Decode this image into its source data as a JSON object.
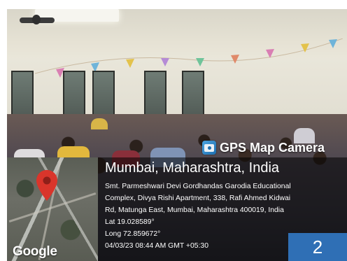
{
  "overlay": {
    "brand_name": "GPS Map Camera",
    "map_attribution": "Google",
    "location_title": "Mumbai, Maharashtra, India",
    "address_lines": [
      "Smt. Parmeshwari Devi Gordhandas Garodia Educational",
      "Complex, Divya Rishi Apartment, 338, Rafi Ahmed Kidwai",
      "Rd, Matunga East, Mumbai, Maharashtra 400019, India"
    ],
    "latitude": "Lat 19.028589°",
    "longitude": "Long 72.859672°",
    "datetime": "04/03/23 08:44 AM GMT +05:30"
  },
  "page_number": "2",
  "colors": {
    "badge": "#2f6fb5",
    "pin": "#d9352b"
  },
  "icons": {
    "brand": "camera-icon",
    "map_marker": "map-pin-icon"
  }
}
